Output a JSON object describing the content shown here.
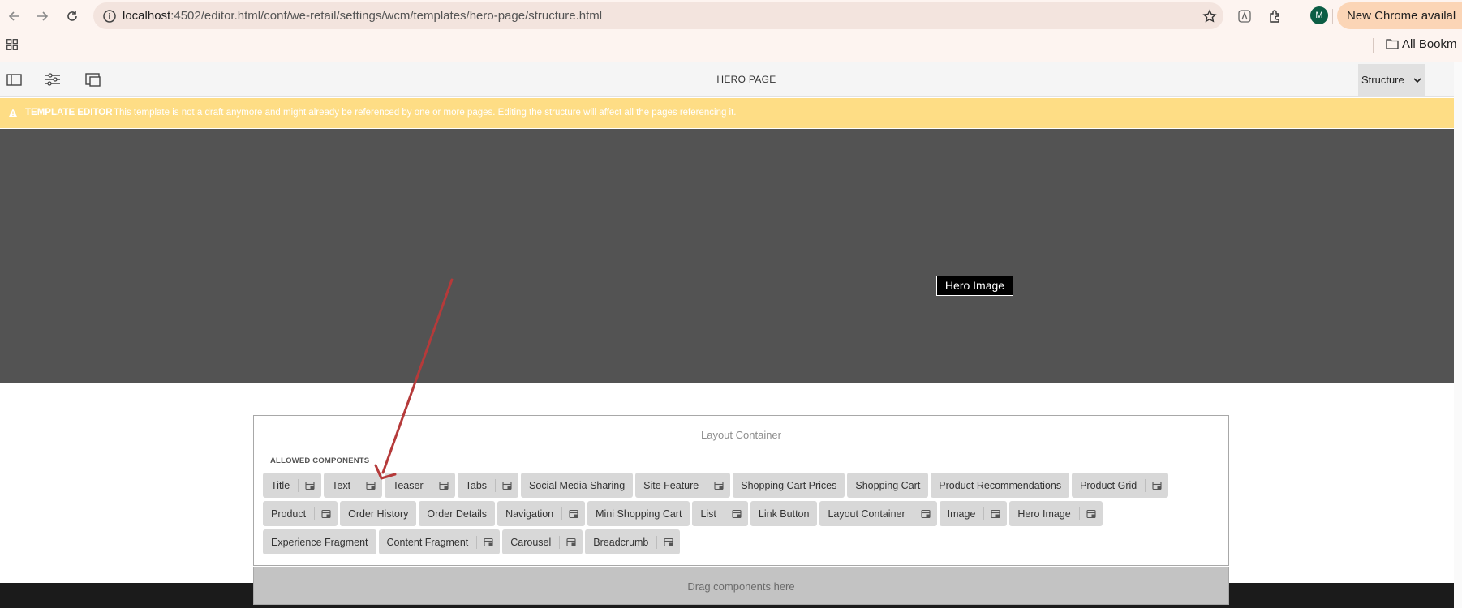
{
  "browser": {
    "url_host": "localhost",
    "url_rest": ":4502/editor.html/conf/we-retail/settings/wcm/templates/hero-page/structure.html",
    "profile_initial": "M",
    "promo_label": "New Chrome availal",
    "bookmarks_label": "All Bookm",
    "icons": [
      "back-arrow-icon",
      "forward-arrow-icon",
      "reload-icon",
      "site-info-icon",
      "star-icon",
      "extension-icon",
      "puzzle-icon",
      "apps-grid-icon",
      "folder-icon"
    ]
  },
  "editor": {
    "page_title": "HERO PAGE",
    "mode": "Structure",
    "toolbar_icons": [
      "side-panel-icon",
      "page-properties-icon",
      "emulator-icon"
    ]
  },
  "alert": {
    "title": "TEMPLATE EDITOR",
    "message": "This template is not a draft anymore and might already be referenced by one or more pages. Editing the structure will affect all the pages referencing it."
  },
  "hero": {
    "label": "Hero Image"
  },
  "layout_container": {
    "title": "Layout Container",
    "allowed_title": "ALLOWED COMPONENTS",
    "rows": [
      [
        {
          "label": "Title",
          "icon": true
        },
        {
          "label": "Text",
          "icon": true
        },
        {
          "label": "Teaser",
          "icon": true
        },
        {
          "label": "Tabs",
          "icon": true
        },
        {
          "label": "Social Media Sharing",
          "icon": false
        },
        {
          "label": "Site Feature",
          "icon": true
        },
        {
          "label": "Shopping Cart Prices",
          "icon": false
        },
        {
          "label": "Shopping Cart",
          "icon": false
        },
        {
          "label": "Product Recommendations",
          "icon": false
        },
        {
          "label": "Product Grid",
          "icon": true
        }
      ],
      [
        {
          "label": "Product",
          "icon": true
        },
        {
          "label": "Order History",
          "icon": false
        },
        {
          "label": "Order Details",
          "icon": false
        },
        {
          "label": "Navigation",
          "icon": true
        },
        {
          "label": "Mini Shopping Cart",
          "icon": false
        },
        {
          "label": "List",
          "icon": true
        },
        {
          "label": "Link Button",
          "icon": false
        },
        {
          "label": "Layout Container",
          "icon": true
        },
        {
          "label": "Image",
          "icon": true
        },
        {
          "label": "Hero Image",
          "icon": true
        }
      ],
      [
        {
          "label": "Experience Fragment",
          "icon": false
        },
        {
          "label": "Content Fragment",
          "icon": true
        },
        {
          "label": "Carousel",
          "icon": true
        },
        {
          "label": "Breadcrumb",
          "icon": true
        }
      ]
    ],
    "dropzone_label": "Drag components here"
  },
  "colors": {
    "alert_bg": "#fedd85",
    "hero_bg": "#535353",
    "chip_bg": "#d8d8d8",
    "annotation_arrow": "#b53a3a"
  }
}
